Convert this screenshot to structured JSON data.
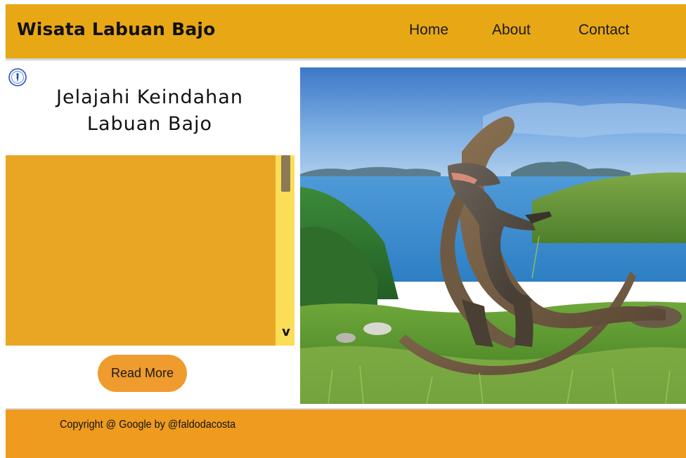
{
  "header": {
    "brand": "Wisata Labuan Bajo",
    "nav": {
      "home": "Home",
      "about": "About",
      "contact": "Contact"
    }
  },
  "hero": {
    "title_line1": "Jelajahi Keindahan",
    "title_line2": "Labuan Bajo",
    "scroll_arrow": "v",
    "read_more": "Read More"
  },
  "footer": {
    "copyright": "Copyright @ Google by @faldodacosta"
  },
  "colors": {
    "header_bg": "#e8a815",
    "panel_bg": "#e9a625",
    "scroll_track": "#fbdd57",
    "button_bg": "#ef9b2d",
    "footer_bg": "#ef9b1f"
  },
  "icons": {
    "logo": "circular-emblem-icon",
    "scroll_down": "chevron-down-icon"
  }
}
